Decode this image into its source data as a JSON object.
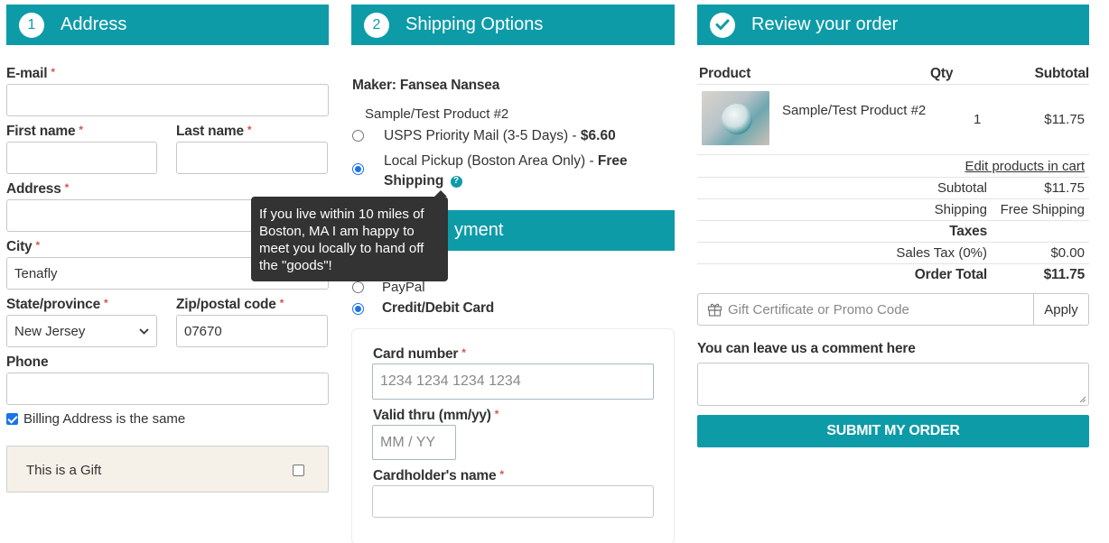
{
  "address": {
    "step": "1",
    "title": "Address",
    "email_label": "E-mail",
    "email_value": "",
    "first_name_label": "First name",
    "first_name_value": "",
    "last_name_label": "Last name",
    "last_name_value": "",
    "address_label": "Address",
    "address_value": "",
    "city_label": "City",
    "city_value": "Tenafly",
    "state_label": "State/province",
    "state_value": "New Jersey",
    "zip_label": "Zip/postal code",
    "zip_value": "07670",
    "phone_label": "Phone",
    "phone_value": "",
    "billing_same_label": "Billing Address is the same",
    "billing_same_checked": true,
    "gift_label": "This is a Gift",
    "gift_checked": false,
    "required_mark": "*"
  },
  "shipping": {
    "step": "2",
    "title": "Shipping Options",
    "maker": "Maker: Fansea Nansea",
    "product": "Sample/Test Product #2",
    "option1": "USPS Priority Mail (3-5 Days) - ",
    "option1_price": "$6.60",
    "option2": "Local Pickup (Boston Area Only) - ",
    "option2_price_line1": "Free",
    "option2_price_line2": "Shipping",
    "selected_option": 2,
    "help_icon": "?",
    "tooltip": "If you live within 10 miles of Boston, MA I am happy to meet you locally to hand off the \"goods\"!"
  },
  "payment": {
    "title_visible": "yment",
    "paypal": "PayPal",
    "card": "Credit/Debit Card",
    "selected": "card",
    "card_number_label": "Card number",
    "card_number_placeholder": "1234 1234 1234 1234",
    "valid_thru_label": "Valid thru (mm/yy)",
    "valid_thru_placeholder": "MM / YY",
    "cardholder_label": "Cardholder's name",
    "cardholder_value": ""
  },
  "review": {
    "title": "Review your order",
    "col_product": "Product",
    "col_qty": "Qty",
    "col_subtotal": "Subtotal",
    "item_name": "Sample/Test Product #2",
    "item_qty": "1",
    "item_subtotal": "$11.75",
    "edit_link": "Edit products in cart",
    "subtotal_label": "Subtotal",
    "subtotal_value": "$11.75",
    "shipping_label": "Shipping",
    "shipping_value": "Free Shipping",
    "taxes_label": "Taxes",
    "sales_tax_label": "Sales Tax (0%)",
    "sales_tax_value": "$0.00",
    "order_total_label": "Order Total",
    "order_total_value": "$11.75",
    "promo_placeholder": "Gift Certificate or Promo Code",
    "apply_label": "Apply",
    "comment_label": "You can leave us a comment here",
    "comment_value": "",
    "submit_label": "SUBMIT MY ORDER"
  },
  "colors": {
    "accent": "#0e9ba8",
    "required": "#d9534f",
    "tooltip_bg": "#333333",
    "gift_bg": "#f5f1e8"
  }
}
